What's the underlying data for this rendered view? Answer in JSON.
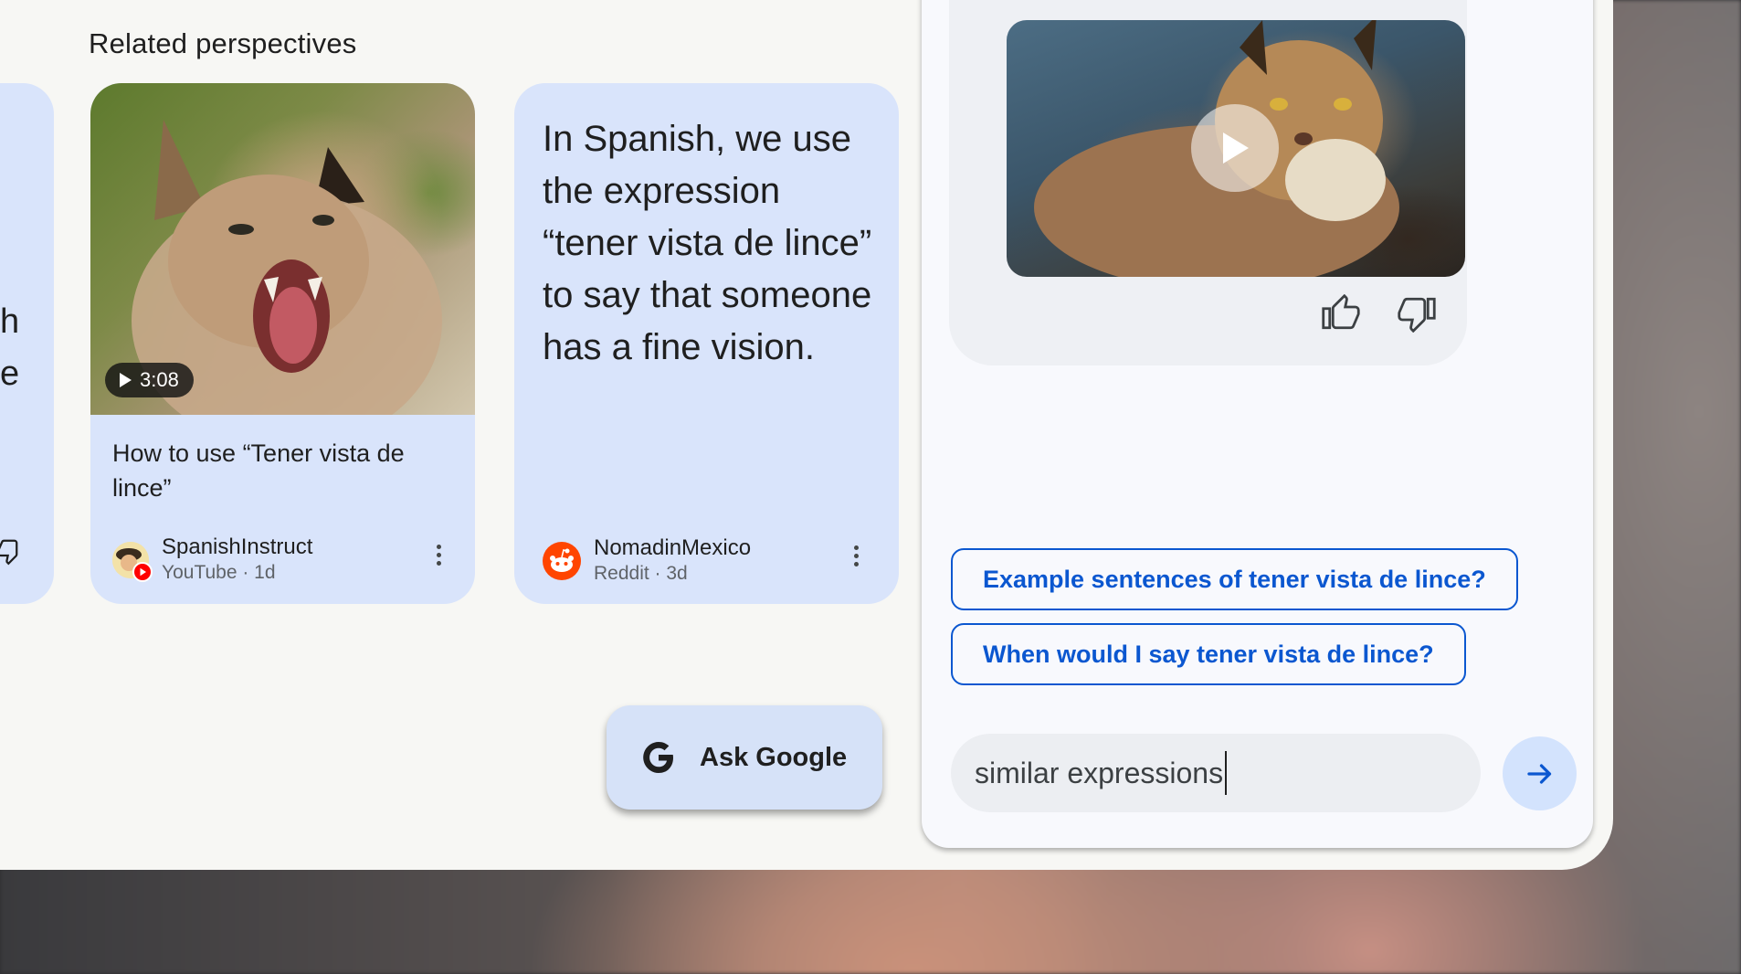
{
  "section": {
    "title": "Related perspectives"
  },
  "left_card": {
    "fragments": [
      "h",
      "e"
    ]
  },
  "video_card": {
    "duration": "3:08",
    "title": "How to use “Tener vista de lince”",
    "source_name": "SpanishInstruct",
    "source_sub": "YouTube · 1d"
  },
  "quote_card": {
    "text": "In Spanish, we use the expression “tener vista de lince” to say that someone has a fine vision.",
    "source_name": "NomadinMexico",
    "source_sub": "Reddit · 3d"
  },
  "ask": {
    "label": "Ask Google"
  },
  "panel": {
    "suggestions": [
      "Example sentences of tener vista de lince?",
      "When would I say tener vista de lince?"
    ],
    "input_value": "similar expressions"
  },
  "colors": {
    "card_bg": "#d9e4fb",
    "accent": "#0b57d0",
    "reddit": "#ff4500",
    "youtube": "#ff0000"
  },
  "icons": [
    "play-icon",
    "youtube-badge-icon",
    "reddit-icon",
    "more-vert-icon",
    "google-g-icon",
    "thumb-up-icon",
    "thumb-down-icon",
    "send-arrow-icon"
  ]
}
